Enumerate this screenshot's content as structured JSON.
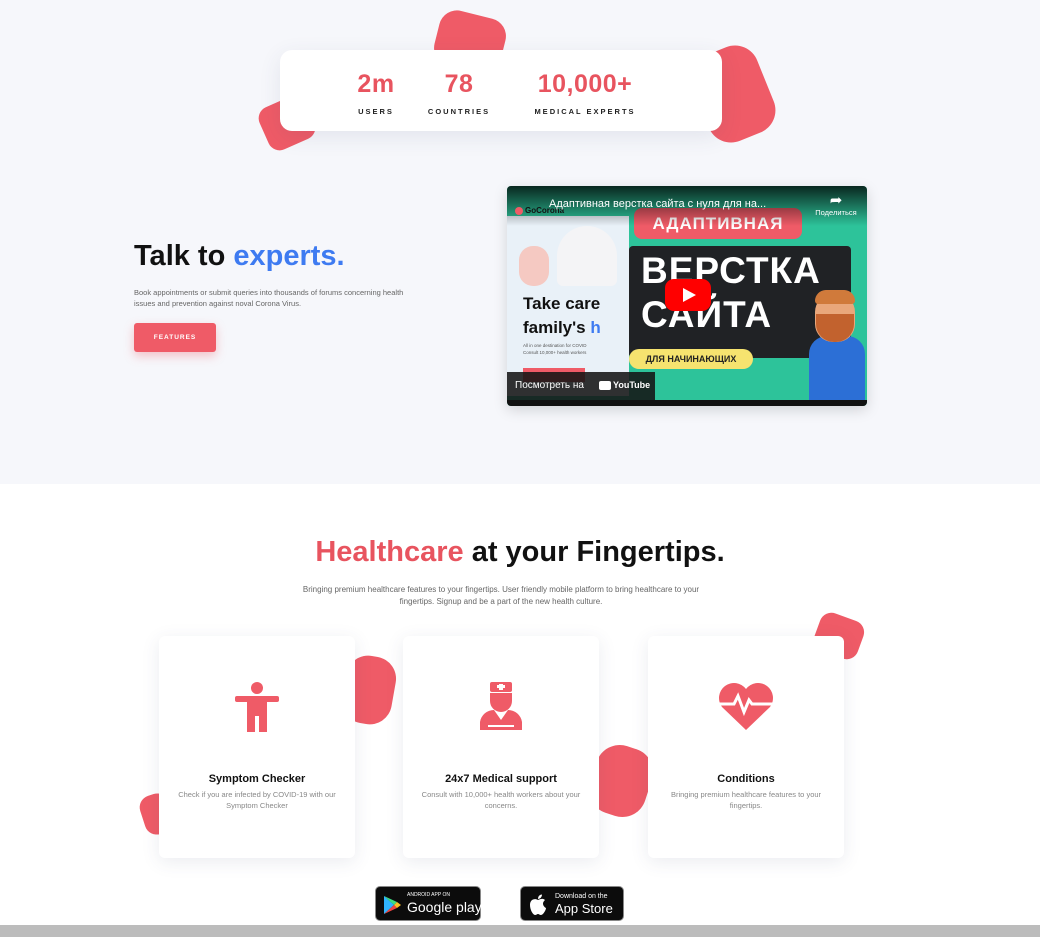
{
  "colors": {
    "accent": "#ef5b67",
    "blue": "#3e7bf1",
    "hero_bg": "#f6f7fb"
  },
  "stats": [
    {
      "value": "2m",
      "label": "USERS"
    },
    {
      "value": "78",
      "label": "COUNTRIES"
    },
    {
      "value": "10,000+",
      "label": "MEDICAL EXPERTS"
    }
  ],
  "hero": {
    "title_plain": "Talk to ",
    "title_accent": "experts.",
    "description": "Book appointments or submit queries into thousands of forums concerning health issues and prevention against noval Corona Virus.",
    "button_label": "FEATURES"
  },
  "video": {
    "title": "Адаптивная верстка сайта с нуля для на...",
    "channel": "GoCorona",
    "share_label": "Поделиться",
    "badge_top": "АДАПТИВНАЯ",
    "line1": "ВЕРСТКА",
    "line2": "САЙТА",
    "badge_bottom": "ДЛЯ НАЧИНАЮЩИХ",
    "left_heading_1": "Take care",
    "left_heading_2": "family's ",
    "left_heading_2_hl": "h",
    "left_small_1": "All in one destination for COVID",
    "left_small_2": "Consult 10,000+ health workers",
    "watch_label": "Посмотреть на",
    "youtube_label": "YouTube",
    "icons": {
      "play": "play-icon",
      "share": "share-arrow-icon",
      "youtube": "youtube-logo-icon"
    }
  },
  "section": {
    "title_red": "Healthcare",
    "title_rest": " at your Fingertips.",
    "description": "Bringing premium healthcare features to your fingertips. User friendly mobile platform to bring healthcare to your fingertips. Signup and be a part of the new health culture."
  },
  "cards": [
    {
      "icon": "accessibility-person-icon",
      "title": "Symptom Checker",
      "description": "Check if you are infected by COVID-19 with our Symptom Checker"
    },
    {
      "icon": "doctor-nurse-icon",
      "title": "24x7 Medical support",
      "description": "Consult with 10,000+ health workers about your concerns."
    },
    {
      "icon": "heart-pulse-icon",
      "title": "Conditions",
      "description": "Bringing premium healthcare features to your fingertips."
    }
  ],
  "stores": {
    "google": {
      "small": "ANDROID APP ON",
      "big": "Google play",
      "icon": "google-play-icon"
    },
    "apple": {
      "small": "Download on the",
      "big": "App Store",
      "icon": "apple-icon"
    }
  }
}
